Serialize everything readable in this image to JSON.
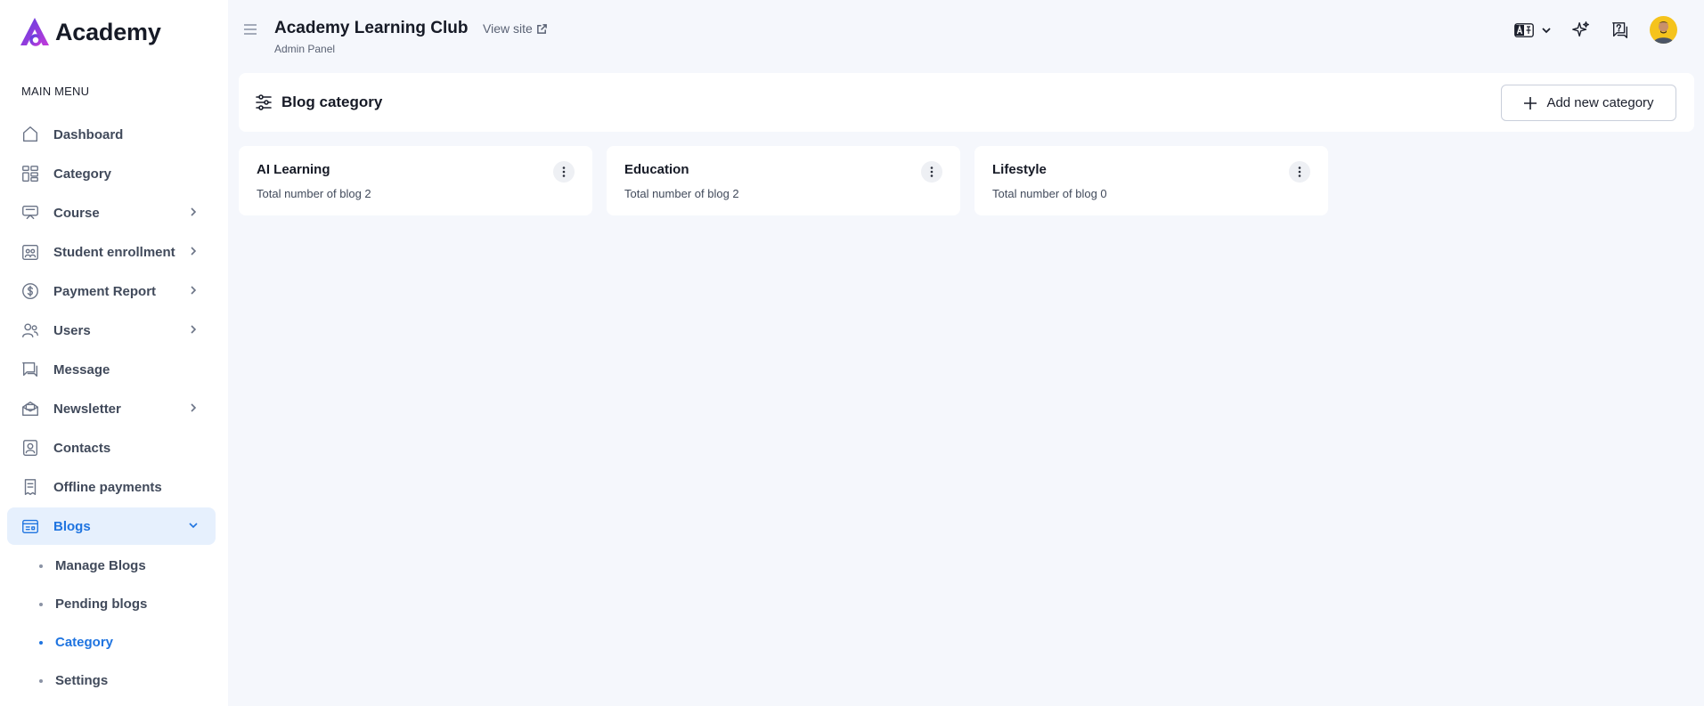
{
  "sidebar": {
    "logo_text": "Academy",
    "menu_heading": "MAIN MENU",
    "items": [
      {
        "label": "Dashboard"
      },
      {
        "label": "Category"
      },
      {
        "label": "Course"
      },
      {
        "label": "Student enrollment"
      },
      {
        "label": "Payment Report"
      },
      {
        "label": "Users"
      },
      {
        "label": "Message"
      },
      {
        "label": "Newsletter"
      },
      {
        "label": "Contacts"
      },
      {
        "label": "Offline payments"
      },
      {
        "label": "Blogs"
      }
    ],
    "blog_submenu": [
      {
        "label": "Manage Blogs"
      },
      {
        "label": "Pending blogs"
      },
      {
        "label": "Category"
      },
      {
        "label": "Settings"
      }
    ]
  },
  "header": {
    "title": "Academy Learning Club",
    "subtitle": "Admin Panel",
    "view_site": "View site"
  },
  "page": {
    "title": "Blog category",
    "add_button": "Add new category"
  },
  "cards": [
    {
      "name": "AI Learning",
      "count_text": "Total number of blog 2"
    },
    {
      "name": "Education",
      "count_text": "Total number of blog 2"
    },
    {
      "name": "Lifestyle",
      "count_text": "Total number of blog 0"
    }
  ],
  "colors": {
    "accent": "#1f74e0",
    "active_bg": "#e6f0fd",
    "page_bg": "#f5f7fc",
    "logo_gradient_start": "#5a3fe0",
    "logo_gradient_end": "#c23ad9",
    "avatar_bg": "#f5c31c"
  }
}
